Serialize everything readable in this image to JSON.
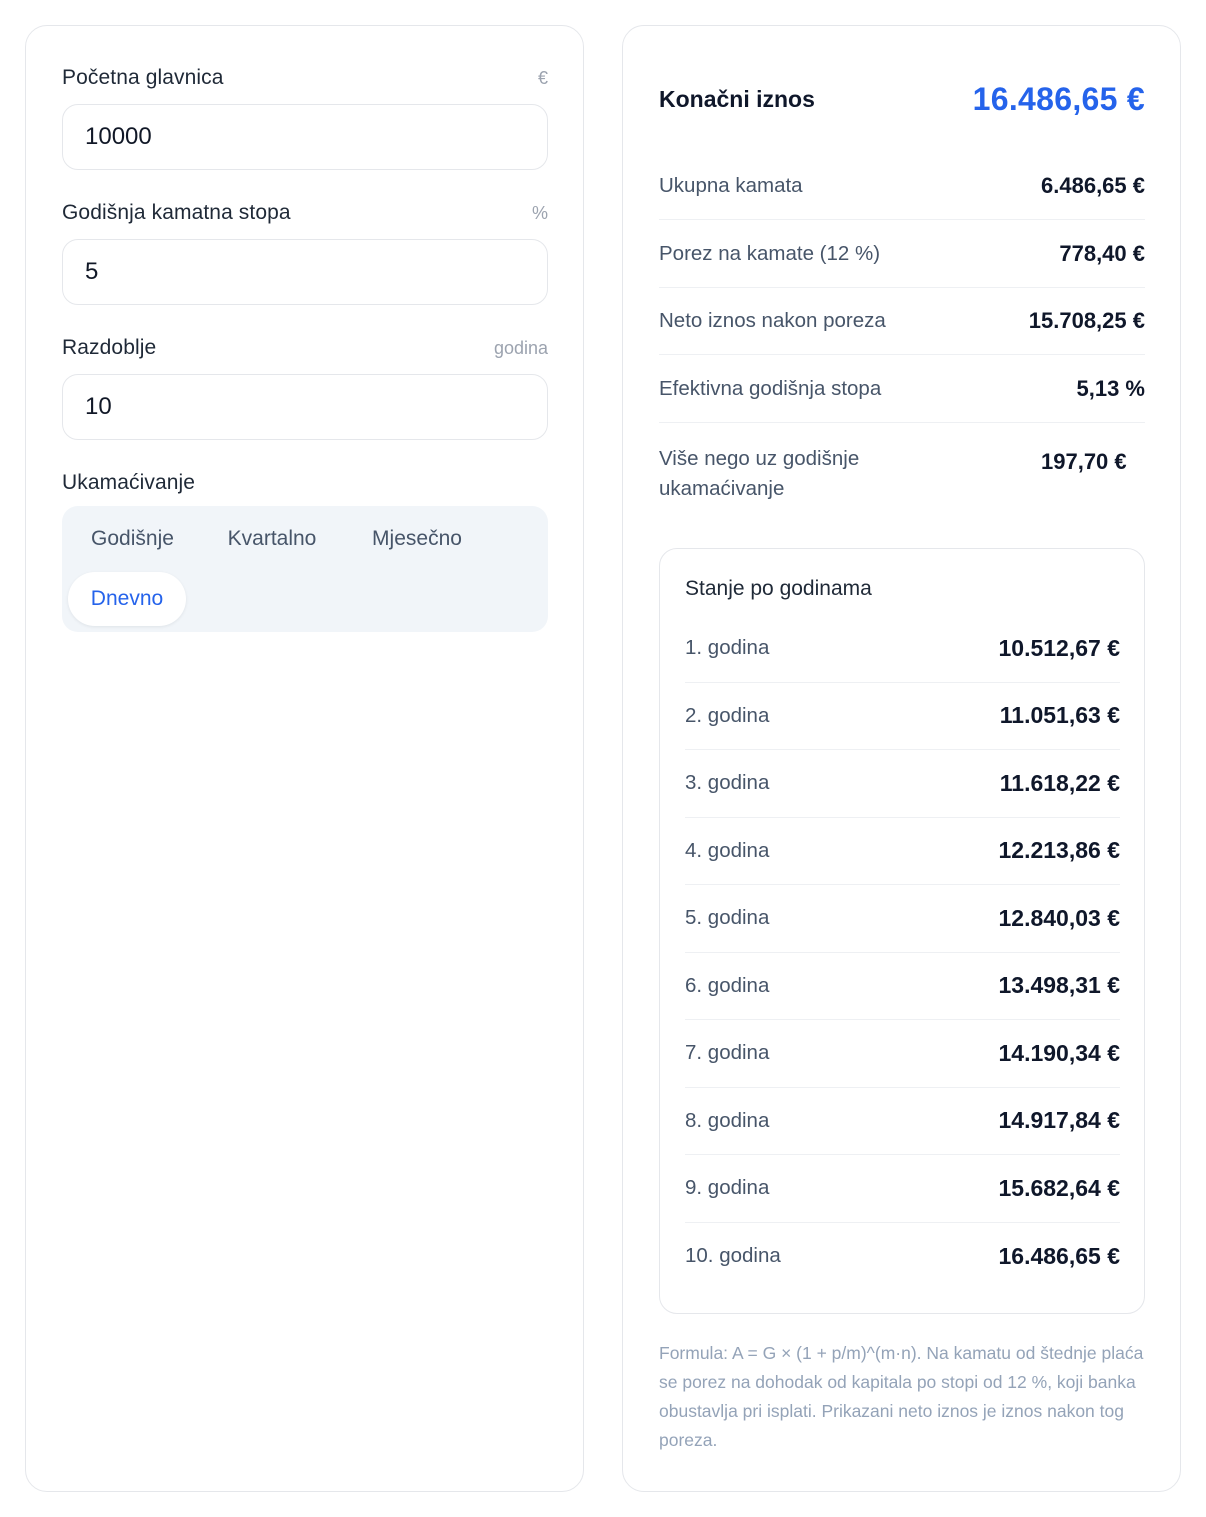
{
  "form": {
    "principal": {
      "label": "Početna glavnica",
      "unit": "€",
      "value": "10000"
    },
    "rate": {
      "label": "Godišnja kamatna stopa",
      "unit": "%",
      "value": "5"
    },
    "period": {
      "label": "Razdoblje",
      "unit": "godina",
      "value": "10"
    },
    "compounding": {
      "label": "Ukamaćivanje",
      "options": [
        "Godišnje",
        "Kvartalno",
        "Mjesečno",
        "Dnevno"
      ],
      "selected": "Dnevno"
    }
  },
  "results": {
    "final": {
      "label": "Konačni iznos",
      "value": "16.486,65 €"
    },
    "stats": [
      {
        "label": "Ukupna kamata",
        "value": "6.486,65 €"
      },
      {
        "label": "Porez na kamate (12 %)",
        "value": "778,40 €"
      },
      {
        "label": "Neto iznos nakon poreza",
        "value": "15.708,25 €"
      },
      {
        "label": "Efektivna godišnja stopa",
        "value": "5,13 %"
      },
      {
        "label": "Više nego uz godišnje ukamaćivanje",
        "value": "197,70 €"
      }
    ],
    "yearly": {
      "title": "Stanje po godinama",
      "rows": [
        {
          "label": "1. godina",
          "value": "10.512,67 €"
        },
        {
          "label": "2. godina",
          "value": "11.051,63 €"
        },
        {
          "label": "3. godina",
          "value": "11.618,22 €"
        },
        {
          "label": "4. godina",
          "value": "12.213,86 €"
        },
        {
          "label": "5. godina",
          "value": "12.840,03 €"
        },
        {
          "label": "6. godina",
          "value": "13.498,31 €"
        },
        {
          "label": "7. godina",
          "value": "14.190,34 €"
        },
        {
          "label": "8. godina",
          "value": "14.917,84 €"
        },
        {
          "label": "9. godina",
          "value": "15.682,64 €"
        },
        {
          "label": "10. godina",
          "value": "16.486,65 €"
        }
      ]
    },
    "note": "Formula: A = G × (1 + p/m)^(m·n). Na kamatu od štednje plaća se porez na dohodak od kapitala po stopi od 12 %, koji banka obustavlja pri isplati. Prikazani neto iznos je iznos nakon tog poreza."
  },
  "colors": {
    "accent": "#2563eb",
    "border": "#e5e7eb",
    "segment_bg": "#f1f5f9",
    "muted": "#94a3b8"
  }
}
